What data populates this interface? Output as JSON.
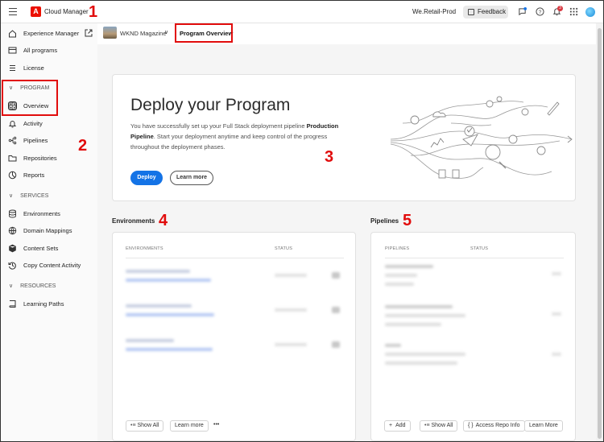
{
  "topbar": {
    "app_title": "Cloud Manager",
    "org": "We.Retail-Prod",
    "feedback_label": "Feedback",
    "notification_count": "3"
  },
  "annotations": [
    "1",
    "2",
    "3",
    "4",
    "5"
  ],
  "sidebar": {
    "items": [
      {
        "label": "Experience Manager",
        "icon": "home-icon"
      },
      {
        "label": "All programs",
        "icon": "programs-icon"
      },
      {
        "label": "License",
        "icon": "license-icon"
      }
    ],
    "program_section": {
      "label": "PROGRAM",
      "items": [
        {
          "label": "Overview",
          "icon": "overview-icon",
          "active": true
        },
        {
          "label": "Activity",
          "icon": "bell-icon"
        },
        {
          "label": "Pipelines",
          "icon": "pipeline-icon"
        },
        {
          "label": "Repositories",
          "icon": "folder-icon"
        },
        {
          "label": "Reports",
          "icon": "reports-icon"
        }
      ]
    },
    "services_section": {
      "label": "SERVICES",
      "items": [
        {
          "label": "Environments",
          "icon": "database-icon"
        },
        {
          "label": "Domain Mappings",
          "icon": "globe-icon"
        },
        {
          "label": "Content Sets",
          "icon": "box-icon"
        },
        {
          "label": "Copy Content Activity",
          "icon": "history-icon"
        }
      ]
    },
    "resources_section": {
      "label": "RESOURCES",
      "items": [
        {
          "label": "Learning Paths",
          "icon": "book-icon"
        }
      ]
    }
  },
  "breadcrumb": {
    "program": "WKND Magazine",
    "current": "Program Overview"
  },
  "hero": {
    "title": "Deploy your Program",
    "text_part1": "You have successfully set up your Full Stack deployment pipeline ",
    "text_bold": "Production Pipeline",
    "text_part2": ". Start your deployment anytime and keep control of the progress throughout the deployment phases.",
    "deploy_label": "Deploy",
    "learn_more_label": "Learn more"
  },
  "environments": {
    "title": "Environments",
    "col_env": "ENVIRONMENTS",
    "col_status": "STATUS",
    "footer": {
      "show_all": "Show All",
      "learn_more": "Learn more",
      "more": "•••"
    }
  },
  "pipelines": {
    "title": "Pipelines",
    "col_pipelines": "PIPELINES",
    "col_status": "STATUS",
    "footer": {
      "add": "Add",
      "show_all": "Show All",
      "access_repo": "Access Repo Info",
      "learn_more": "Learn More"
    }
  },
  "colors": {
    "accent": "#1473e6",
    "adobe_red": "#eb1000",
    "annotation_red": "#e10c0c"
  }
}
